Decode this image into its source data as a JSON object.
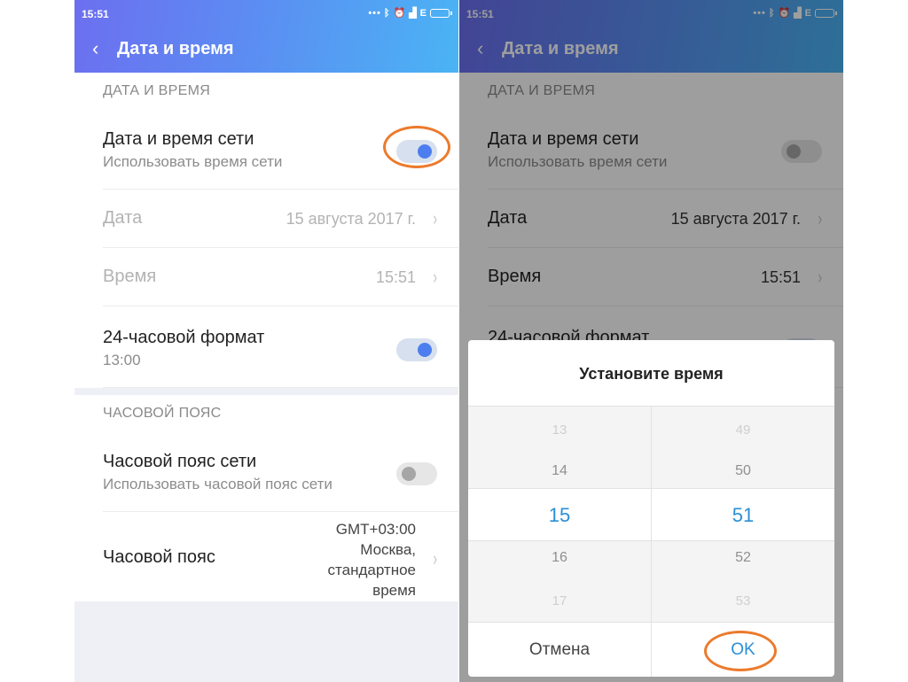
{
  "status_bar": {
    "time": "15:51",
    "network": "E"
  },
  "header": {
    "title": "Дата и время"
  },
  "sections": {
    "date_time_label": "ДАТА И ВРЕМЯ",
    "timezone_label": "ЧАСОВОЙ ПОЯС"
  },
  "rows": {
    "network_time": {
      "title": "Дата и время сети",
      "subtitle": "Использовать время сети",
      "toggle_left": true,
      "toggle_right": false
    },
    "date": {
      "title": "Дата",
      "value": "15 августа 2017 г."
    },
    "time": {
      "title": "Время",
      "value": "15:51"
    },
    "format24": {
      "title": "24-часовой формат",
      "subtitle": "13:00",
      "toggle": true
    },
    "network_tz": {
      "title": "Часовой пояс сети",
      "subtitle": "Использовать часовой пояс сети",
      "toggle": false
    },
    "timezone": {
      "title": "Часовой пояс",
      "value_lines": [
        "GMT+03:00",
        "Москва,",
        "стандартное",
        "время"
      ]
    }
  },
  "dialog": {
    "title": "Установите время",
    "hours": [
      "13",
      "14",
      "15",
      "16",
      "17"
    ],
    "minutes": [
      "49",
      "50",
      "51",
      "52",
      "53"
    ],
    "cancel_label": "Отмена",
    "ok_label": "OK"
  },
  "colors": {
    "accent": "#4d7ef0",
    "highlight": "#ec7a2c",
    "picker_selected": "#2b8fd6"
  }
}
